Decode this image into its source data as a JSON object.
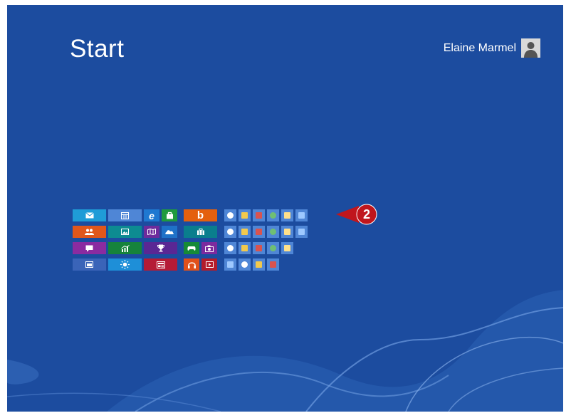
{
  "screen": {
    "title": "Start"
  },
  "user": {
    "name": "Elaine Marmel"
  },
  "callout": {
    "number": "2",
    "color": "#c0161d"
  },
  "colors": {
    "background": "#1c4c9f",
    "tile_light": "#4f86d6"
  },
  "tile_groups": [
    {
      "group": "windows-apps",
      "tiles": [
        {
          "name": "mail-icon",
          "color": "#1f9cd7"
        },
        {
          "name": "calendar-icon",
          "color": "#6f3fae"
        },
        {
          "name": "internet-explorer-icon",
          "color": "#1f78d1"
        },
        {
          "name": "store-icon",
          "color": "#1f9a3e"
        },
        {
          "name": "people-icon",
          "color": "#e1571b"
        },
        {
          "name": "photos-icon",
          "color": "#0d8b91"
        },
        {
          "name": "maps-icon",
          "color": "#6e2c9c"
        },
        {
          "name": "skydrive-icon",
          "color": "#1f72c8"
        },
        {
          "name": "messaging-icon",
          "color": "#8a2ba0"
        },
        {
          "name": "finance-icon",
          "color": "#16833b"
        },
        {
          "name": "sports-icon",
          "color": "#5a2794"
        },
        {
          "name": "desktop-icon",
          "color": "#3a64b8"
        },
        {
          "name": "weather-icon",
          "color": "#1e8fd8"
        },
        {
          "name": "news-icon",
          "color": "#b51b36"
        }
      ]
    },
    {
      "group": "media-apps",
      "tiles": [
        {
          "name": "bing-icon",
          "color": "#e4600e"
        },
        {
          "name": "travel-icon",
          "color": "#0a7e8d"
        },
        {
          "name": "games-icon",
          "color": "#168a37"
        },
        {
          "name": "camera-icon",
          "color": "#7c2a9e"
        },
        {
          "name": "music-icon",
          "color": "#e1501b"
        },
        {
          "name": "video-icon",
          "color": "#b31c2b"
        }
      ]
    },
    {
      "group": "desktop-programs",
      "tiles": [
        {
          "name": "paint-icon"
        },
        {
          "name": "file-icon"
        },
        {
          "name": "wordpad-icon"
        },
        {
          "name": "sticky-notes-icon"
        },
        {
          "name": "access-icon"
        },
        {
          "name": "office-icon"
        },
        {
          "name": "remote-desktop-icon"
        },
        {
          "name": "folder-icon"
        },
        {
          "name": "calculator-icon"
        },
        {
          "name": "excel-icon"
        },
        {
          "name": "explorer-icon"
        },
        {
          "name": "globe-icon"
        },
        {
          "name": "media-center-icon"
        },
        {
          "name": "network-icon"
        },
        {
          "name": "powerpoint-icon"
        },
        {
          "name": "publisher-icon"
        },
        {
          "name": "lync-icon"
        },
        {
          "name": "tools-icon"
        },
        {
          "name": "user-icon"
        },
        {
          "name": "onenote-icon"
        },
        {
          "name": "sharepoint-icon"
        }
      ]
    }
  ]
}
